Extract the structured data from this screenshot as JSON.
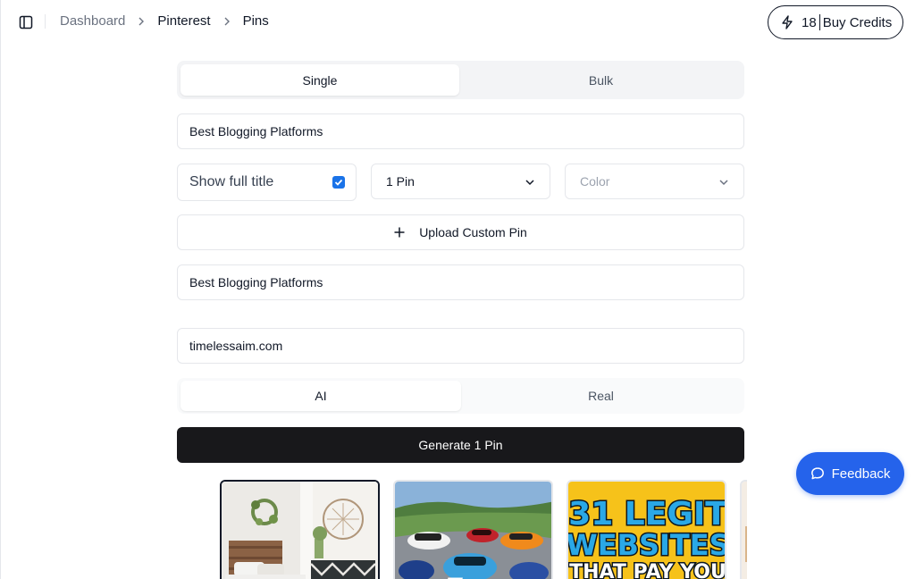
{
  "breadcrumb": {
    "items": [
      "Dashboard",
      "Pinterest",
      "Pins"
    ]
  },
  "credits": {
    "count": "18",
    "label": "Buy Credits"
  },
  "mode_tabs": {
    "single": "Single",
    "bulk": "Bulk",
    "active": "Single"
  },
  "title_input": {
    "value": "Best Blogging Platforms"
  },
  "options": {
    "show_full_title_label": "Show full title",
    "show_full_title_checked": true,
    "pin_count_selected": "1 Pin",
    "color_placeholder": "Color"
  },
  "upload": {
    "label": "Upload Custom Pin"
  },
  "description_input": {
    "value": "Best Blogging Platforms"
  },
  "url_input": {
    "value": "timelessaim.com"
  },
  "image_tabs": {
    "ai": "AI",
    "real": "Real",
    "active": "AI"
  },
  "generate": {
    "label": "Generate 1 Pin"
  },
  "thumbnails": [
    {
      "name": "bedroom-interior-image",
      "selected": true
    },
    {
      "name": "sports-cars-image",
      "selected": false
    },
    {
      "name": "31-legit-websites-image",
      "text": "31 LEGIT WEBSITES THAT PAY YOU",
      "selected": false
    }
  ],
  "feedback": {
    "label": "Feedback"
  },
  "colors": {
    "accent_blue": "#2563eb",
    "checkbox_blue": "#1a73e8",
    "primary_dark": "#18181b",
    "tab_bg": "#f3f4f6"
  }
}
